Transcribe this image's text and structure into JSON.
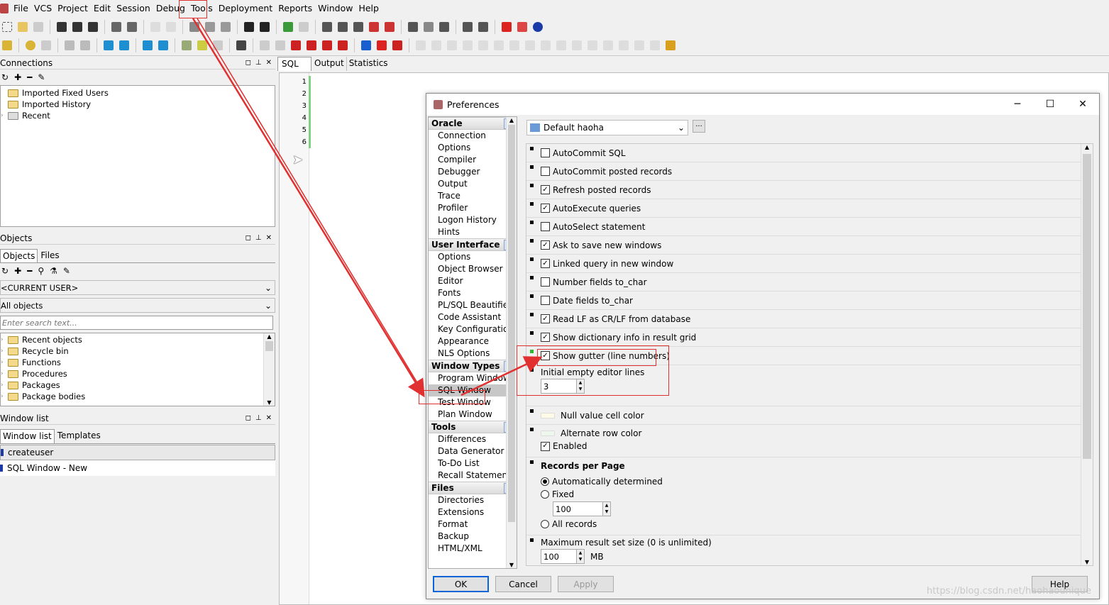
{
  "menu": [
    "File",
    "VCS",
    "Project",
    "Edit",
    "Session",
    "Debug",
    "Tools",
    "Deployment",
    "Reports",
    "Window",
    "Help"
  ],
  "connections": {
    "title": "Connections",
    "items": [
      "Imported Fixed Users",
      "Imported History",
      "Recent"
    ]
  },
  "objects": {
    "title": "Objects",
    "tabs": [
      "Objects",
      "Files"
    ],
    "user_combo": "<CURRENT USER>",
    "filter_combo": "All objects",
    "search_placeholder": "Enter search text...",
    "items": [
      "Recent objects",
      "Recycle bin",
      "Functions",
      "Procedures",
      "Packages",
      "Package bodies"
    ]
  },
  "windowlist": {
    "title": "Window list",
    "tabs": [
      "Window list",
      "Templates"
    ],
    "items": [
      "createuser",
      "SQL Window - New"
    ]
  },
  "editor": {
    "tabs": [
      "SQL",
      "Output",
      "Statistics"
    ],
    "line_numbers": [
      "1",
      "2",
      "3",
      "4",
      "5",
      "6"
    ]
  },
  "dialog": {
    "title": "Preferences",
    "profile": "Default haoha",
    "categories": [
      {
        "name": "Oracle",
        "items": [
          "Connection",
          "Options",
          "Compiler",
          "Debugger",
          "Output",
          "Trace",
          "Profiler",
          "Logon History",
          "Hints"
        ]
      },
      {
        "name": "User Interface",
        "items": [
          "Options",
          "Object Browser",
          "Editor",
          "Fonts",
          "PL/SQL Beautifier",
          "Code Assistant",
          "Key Configuration",
          "Appearance",
          "NLS Options"
        ]
      },
      {
        "name": "Window Types",
        "items": [
          "Program Window",
          "SQL Window",
          "Test Window",
          "Plan Window"
        ]
      },
      {
        "name": "Tools",
        "items": [
          "Differences",
          "Data Generator",
          "To-Do List",
          "Recall Statement"
        ]
      },
      {
        "name": "Files",
        "items": [
          "Directories",
          "Extensions",
          "Format",
          "Backup",
          "HTML/XML"
        ]
      }
    ],
    "options": [
      {
        "label": "AutoCommit SQL",
        "checked": false
      },
      {
        "label": "AutoCommit posted records",
        "checked": false
      },
      {
        "label": "Refresh posted records",
        "checked": true
      },
      {
        "label": "AutoExecute queries",
        "checked": true
      },
      {
        "label": "AutoSelect statement",
        "checked": false
      },
      {
        "label": "Ask to save new windows",
        "checked": true
      },
      {
        "label": "Linked query in new window",
        "checked": true
      },
      {
        "label": "Number fields to_char",
        "checked": false
      },
      {
        "label": "Date fields to_char",
        "checked": false
      },
      {
        "label": "Read LF as CR/LF from database",
        "checked": true
      },
      {
        "label": "Show dictionary info in result grid",
        "checked": true
      },
      {
        "label": "Show gutter (line numbers)",
        "checked": true
      }
    ],
    "initial_lines_label": "Initial empty editor lines",
    "initial_lines_value": "3",
    "null_color_label": "Null value cell color",
    "alt_row_label": "Alternate row color",
    "enabled_label": "Enabled",
    "records_per_page": {
      "title": "Records per Page",
      "auto": "Automatically determined",
      "fixed": "Fixed",
      "fixed_value": "100",
      "all": "All records"
    },
    "max_result_label": "Maximum result set size (0 is unlimited)",
    "max_result_value": "100",
    "max_result_unit": "MB",
    "buttons": {
      "ok": "OK",
      "cancel": "Cancel",
      "apply": "Apply",
      "help": "Help"
    }
  },
  "watermark": "https://blog.csdn.net/haohaounique",
  "colors": {
    "annotation_red": "#e03030",
    "gutter_green": "#2db82d"
  }
}
